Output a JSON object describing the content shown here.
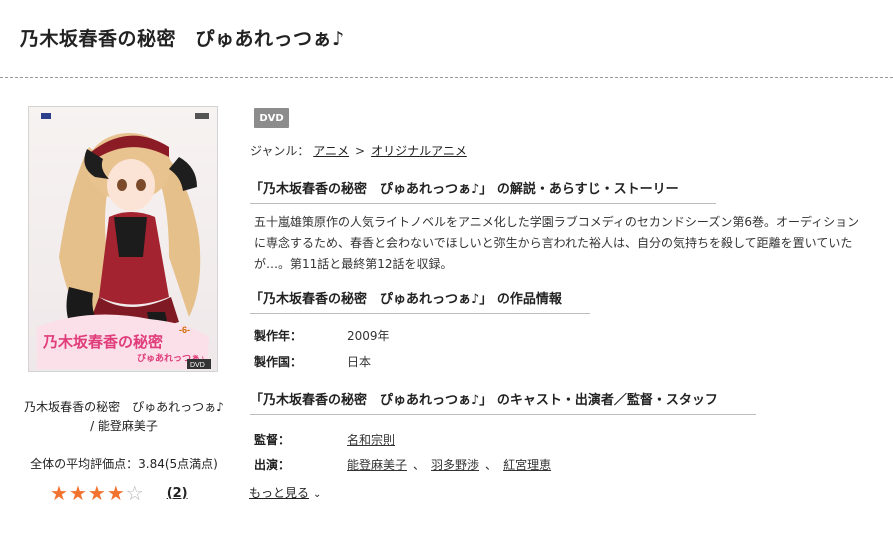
{
  "header": {
    "title": "乃木坂春香の秘密　ぴゅあれっつぁ♪"
  },
  "product": {
    "badge": "DVD",
    "genre_label": "ジャンル：",
    "genres": [
      "アニメ",
      "オリジナルアニメ"
    ],
    "genre_separator": ">"
  },
  "cover": {
    "caption_title": "乃木坂春香の秘密　ぴゅあれっつぁ♪",
    "caption_separator": " / ",
    "caption_author": "能登麻美子",
    "avg_rating_text": "全体の平均評価点：3.84(5点満点)",
    "rating_value": 3.84,
    "stars": [
      "full",
      "full",
      "full",
      "full",
      "empty"
    ],
    "review_count": "(2)"
  },
  "synopsis": {
    "heading": "「乃木坂春香の秘密　ぴゅあれっつぁ♪」 の解説・あらすじ・ストーリー",
    "text": "五十嵐雄策原作の人気ライトノベルをアニメ化した学園ラブコメディのセカンドシーズン第6巻。オーディションに専念するため、春香と会わないでほしいと弥生から言われた裕人は、自分の気持ちを殺して距離を置いていたが…。第11話と最終第12話を収録。"
  },
  "work_info": {
    "heading": "「乃木坂春香の秘密　ぴゅあれっつぁ♪」 の作品情報",
    "year_label": "製作年：",
    "year_value": "2009年",
    "country_label": "製作国：",
    "country_value": "日本"
  },
  "cast": {
    "heading": "「乃木坂春香の秘密　ぴゅあれっつぁ♪」 のキャスト・出演者／監督・スタッフ",
    "director_label": "監督：",
    "director": "名和宗則",
    "performers_label": "出演：",
    "performers": [
      "能登麻美子",
      "羽多野渉",
      "紅宮理恵"
    ],
    "separator": "、",
    "more_label": "もっと見る"
  },
  "colors": {
    "star_full": "#f2732f",
    "star_empty": "#b8b8b8",
    "badge_bg": "#8c8c8c"
  }
}
